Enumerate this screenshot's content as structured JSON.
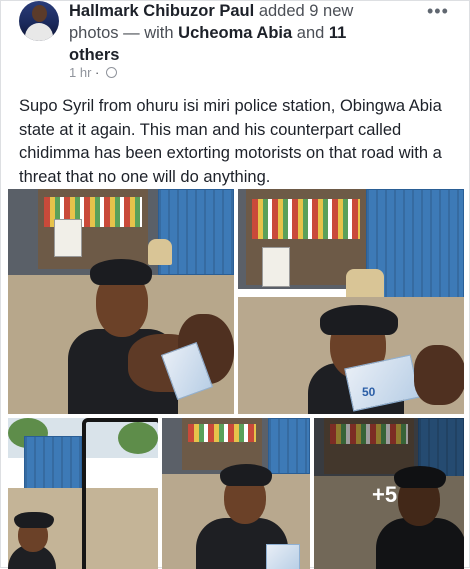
{
  "post": {
    "author": "Hallmark Chibuzor Paul",
    "action": "added 9 new photos",
    "with_prefix": "— with",
    "tagged_person": "Ucheoma Abia",
    "and_word": "and",
    "others": "11 others",
    "timestamp": "1 hr",
    "privacy_icon": "globe-icon",
    "more_label": "•••",
    "text": "Supo Syril from ohuru isi miri police station, Obingwa Abia state at it again. This man and his counterpart called chidimma has been extorting motorists on that road with a threat that no one will do anything."
  },
  "photos": {
    "count": 5,
    "more_count": "+5",
    "note_label": "50"
  },
  "colors": {
    "link": "#1d2129",
    "muted": "#90949c",
    "container_blue": "#3d7ab7"
  }
}
